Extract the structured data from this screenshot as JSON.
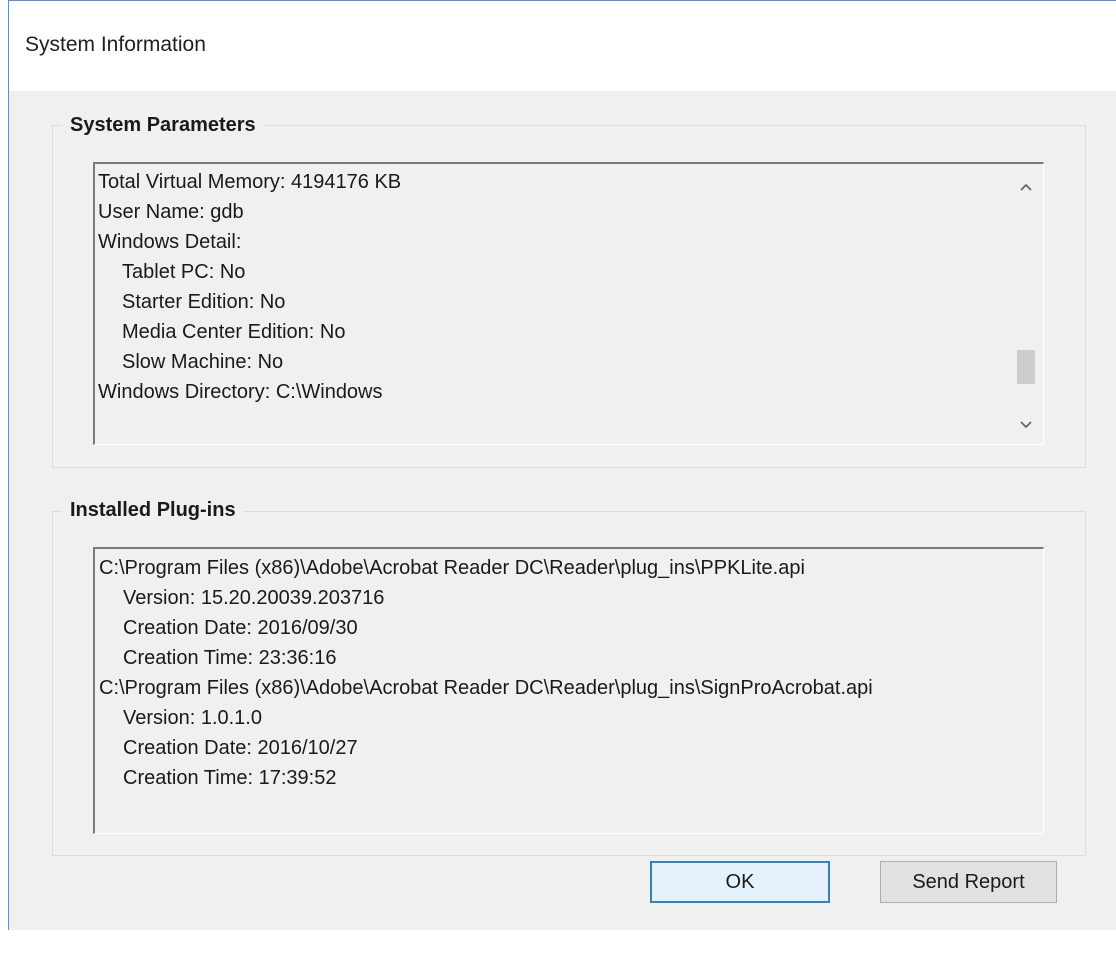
{
  "window": {
    "title": "System Information"
  },
  "system_parameters": {
    "label": "System Parameters",
    "lines": [
      {
        "text": "Total Virtual Memory: 4194176 KB",
        "indent": 0
      },
      {
        "text": "User Name: gdb",
        "indent": 0
      },
      {
        "text": "Windows Detail:",
        "indent": 0
      },
      {
        "text": "Tablet PC: No",
        "indent": 1
      },
      {
        "text": "Starter Edition: No",
        "indent": 1
      },
      {
        "text": "Media Center Edition: No",
        "indent": 1
      },
      {
        "text": "Slow Machine: No",
        "indent": 1
      },
      {
        "text": "Windows Directory: C:\\Windows",
        "indent": 0
      }
    ],
    "scroll_position": 0.85
  },
  "installed_plugins": {
    "label": "Installed Plug-ins",
    "lines": [
      {
        "text": "C:\\Program Files (x86)\\Adobe\\Acrobat Reader DC\\Reader\\plug_ins\\PPKLite.api",
        "indent": 0
      },
      {
        "text": "Version: 15.20.20039.203716",
        "indent": 1
      },
      {
        "text": "Creation Date: 2016/09/30",
        "indent": 1
      },
      {
        "text": "Creation Time: 23:36:16",
        "indent": 1
      },
      {
        "text": "C:\\Program Files (x86)\\Adobe\\Acrobat Reader DC\\Reader\\plug_ins\\SignProAcrobat.api",
        "indent": 0
      },
      {
        "text": "Version: 1.0.1.0",
        "indent": 1
      },
      {
        "text": "Creation Date: 2016/10/27",
        "indent": 1
      },
      {
        "text": "Creation Time: 17:39:52",
        "indent": 1
      }
    ]
  },
  "buttons": {
    "ok_label": "OK",
    "send_report_label": "Send Report"
  },
  "icons": {
    "scroll_up": "chevron-up-icon",
    "scroll_down": "chevron-down-icon"
  }
}
